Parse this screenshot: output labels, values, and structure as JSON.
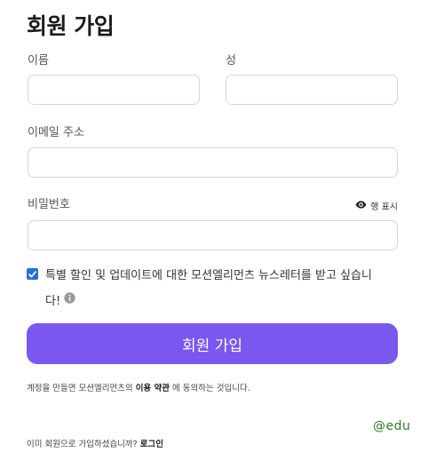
{
  "form": {
    "title": "회원 가입",
    "first_name_label": "이름",
    "first_name_value": "",
    "last_name_label": "성",
    "last_name_value": "",
    "email_label": "이메일 주소",
    "email_value": "",
    "password_label": "비밀번호",
    "password_value": "",
    "show_password_label": "행 표시",
    "show_password_icon": "eye-icon",
    "newsletter_checked": true,
    "newsletter_text": "특별 할인 및 업데이트에 대한 모션엘리먼츠 뉴스레터를 받고 싶습니다!",
    "info_icon": "info-icon",
    "submit_label": "회원 가입"
  },
  "terms": {
    "prefix": "계정을 만들면 모션엘리먼츠의 ",
    "link": "이용 약관",
    "suffix": " 에 동의하는 것입니다."
  },
  "login": {
    "prompt": "이미 회원으로 가입하셨습니까? ",
    "link": "로그인"
  },
  "watermark": "@edu",
  "colors": {
    "accent": "#7a57ee",
    "checkbox": "#2b6fd6",
    "watermark": "#2f7a2f"
  }
}
